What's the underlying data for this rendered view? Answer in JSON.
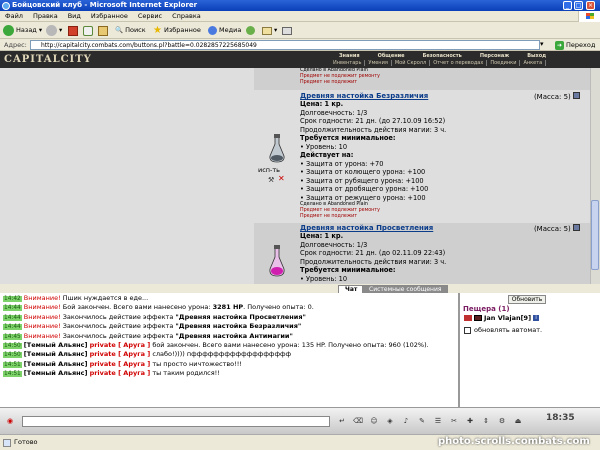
{
  "window": {
    "title": "Бойцовский клуб - Microsoft Internet Explorer"
  },
  "menu": [
    "Файл",
    "Правка",
    "Вид",
    "Избранное",
    "Сервис",
    "Справка"
  ],
  "toolbar": {
    "back": "Назад",
    "search": "Поиск",
    "favorites": "Избранное",
    "media": "Медиа"
  },
  "address": {
    "label": "Адрес:",
    "url": "http://capitalcity.combats.com/buttons.pl?battle=0.0282857225685049",
    "go": "Переход"
  },
  "game": {
    "logo": "CAPITALCITY",
    "nav_top": [
      "Знания",
      "Общение",
      "Безопасность",
      "Персонаж",
      "Выход"
    ],
    "nav_sub": [
      "Инвентарь",
      "Умения",
      "Мой Скролл",
      "Отчет о переводах",
      "Поединки",
      "Анкета"
    ]
  },
  "items": [
    {
      "made_in": "Сделано в Abandoned Plain",
      "note": "Предмет не подлежит ремонту",
      "note2": "Предмет не подлежит",
      "hidden": true
    },
    {
      "name": "Древняя настойка Безразличия",
      "mass": "(Масса: 5)",
      "price": "Цена: 1 кр.",
      "durability": "Долговечность: 1/3",
      "expiry": "Срок годности: 21 дн. (до 27.10.09 16:52)",
      "duration": "Продолжительность действия магии: 3 ч.",
      "req_title": "Требуется минимальное:",
      "req_level": "• Уровень: 10",
      "acts_title": "Действует на:",
      "effects": [
        "• Защита от урона: +70",
        "• Защита от колющего урона: +100",
        "• Защита от рубящего урона: +100",
        "• Защита от дробящего урона: +100",
        "• Защита от режущего урона: +100"
      ],
      "made_in": "Сделано в Abandoned Plain",
      "note": "Предмет не подлежит ремонту",
      "note2": "Предмет не подлежит",
      "action_label": "исп-ть"
    },
    {
      "name": "Древняя настойка Просветления",
      "mass": "(Масса: 5)",
      "price": "Цена: 1 кр.",
      "durability": "Долговечность: 1/3",
      "expiry": "Срок годности: 21 дн. (до 02.11.09 22:43)",
      "duration": "Продолжительность действия магии: 3 ч.",
      "req_title": "Требуется минимальное:",
      "req_level": "• Уровень: 10"
    }
  ],
  "tabs": {
    "chat": "Чат",
    "system": "Системные сообщения"
  },
  "chat": [
    {
      "ts": "14:42",
      "warn": "Внимание!",
      "text": " Пшик нуждается в еде..."
    },
    {
      "ts": "14:44",
      "warn": "Внимание!",
      "text": " Бой закончен. Всего вами нанесено урона: ",
      "bold": "3281 HP",
      "tail": ". Получено опыта: 0."
    },
    {
      "ts": "14:44",
      "warn": "Внимание!",
      "text": " Закончилось действие эффекта ",
      "bold": "\"Древняя настойка Просветления\"",
      "tail": ""
    },
    {
      "ts": "14:44",
      "warn": "Внимание!",
      "text": " Закончилось действие эффекта ",
      "bold": "\"Древняя настойка Безразличия\"",
      "tail": ""
    },
    {
      "ts": "14:45",
      "warn": "Внимание!",
      "text": " Закончилось действие эффекта ",
      "bold": "\"Древняя настойка Антимагии\"",
      "tail": ""
    },
    {
      "ts": "14:50",
      "from": "[Темный Альянс]",
      "pvt": "private [ Аруга ]",
      "text": " бой закончен. Всего вами нанесено урона: 135 HP. Получено опыта: 960 (102%)."
    },
    {
      "ts": "14:50",
      "from": "[Темный Альянс]",
      "pvt": "private [ Аруга ]",
      "text": " слабо!)))) пфффффффффффффффффф"
    },
    {
      "ts": "14:51",
      "from": "[Темный Альянс]",
      "pvt": "private [ Аруга ]",
      "text": " ты просто ничтожество!!!"
    },
    {
      "ts": "14:51",
      "from": "[Темный Альянс]",
      "pvt": "private [ Аруга ]",
      "text": " ты таким родился!!"
    }
  ],
  "online": {
    "refresh": "Обновить",
    "location": "Пещера (1)",
    "user": "Jan Vlajan[9]",
    "auto": "обновлять автомат."
  },
  "bottom": {
    "clock": "18:35"
  },
  "status": {
    "text": "Готово",
    "watermark": "photo.scrolls.combats.com"
  },
  "colors": {
    "xp_title": "#0a3fb8",
    "item_name": "#0b3c8a",
    "warning": "#d00000",
    "timestamp_bg": "#7dd36a"
  }
}
